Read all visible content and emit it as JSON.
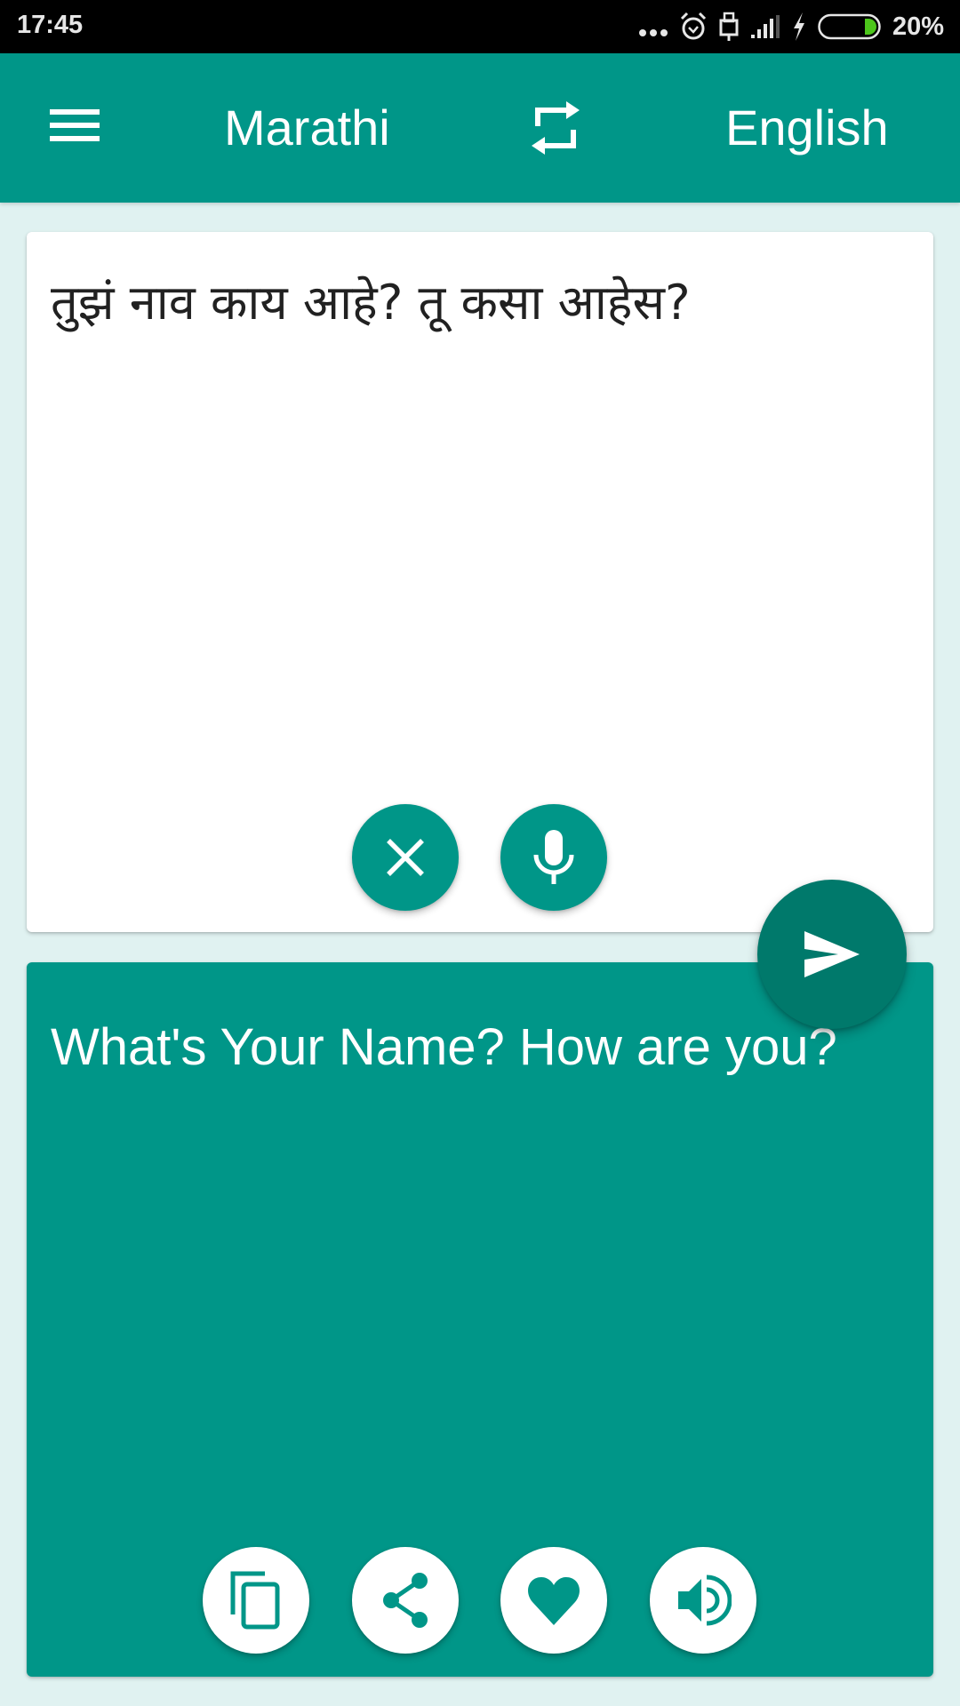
{
  "status_bar": {
    "time": "17:45",
    "battery_percent": "20%",
    "battery_level": 0.2,
    "icons": [
      "more-notifications-icon",
      "alarm-icon",
      "usb-icon",
      "signal-icon",
      "charging-icon",
      "battery-icon"
    ]
  },
  "app_bar": {
    "menu_icon": "hamburger-menu-icon",
    "source_language": "Marathi",
    "swap_icon": "swap-languages-icon",
    "target_language": "English"
  },
  "input_card": {
    "text": "तुझं नाव काय आहे? तू कसा आहेस?",
    "buttons": [
      {
        "name": "clear",
        "icon": "close-icon"
      },
      {
        "name": "voice-input",
        "icon": "microphone-icon"
      }
    ]
  },
  "translate_fab": {
    "icon": "send-icon"
  },
  "output_card": {
    "text": "What's Your Name? How are you?",
    "buttons": [
      {
        "name": "copy",
        "icon": "copy-icon"
      },
      {
        "name": "share",
        "icon": "share-icon"
      },
      {
        "name": "favorite",
        "icon": "heart-icon"
      },
      {
        "name": "speak",
        "icon": "speaker-icon"
      }
    ]
  },
  "colors": {
    "primary": "#009688",
    "primary_dark": "#00796B",
    "background": "#E0F2F1",
    "input_text": "#212121",
    "battery_fill": "#4CC61B"
  }
}
